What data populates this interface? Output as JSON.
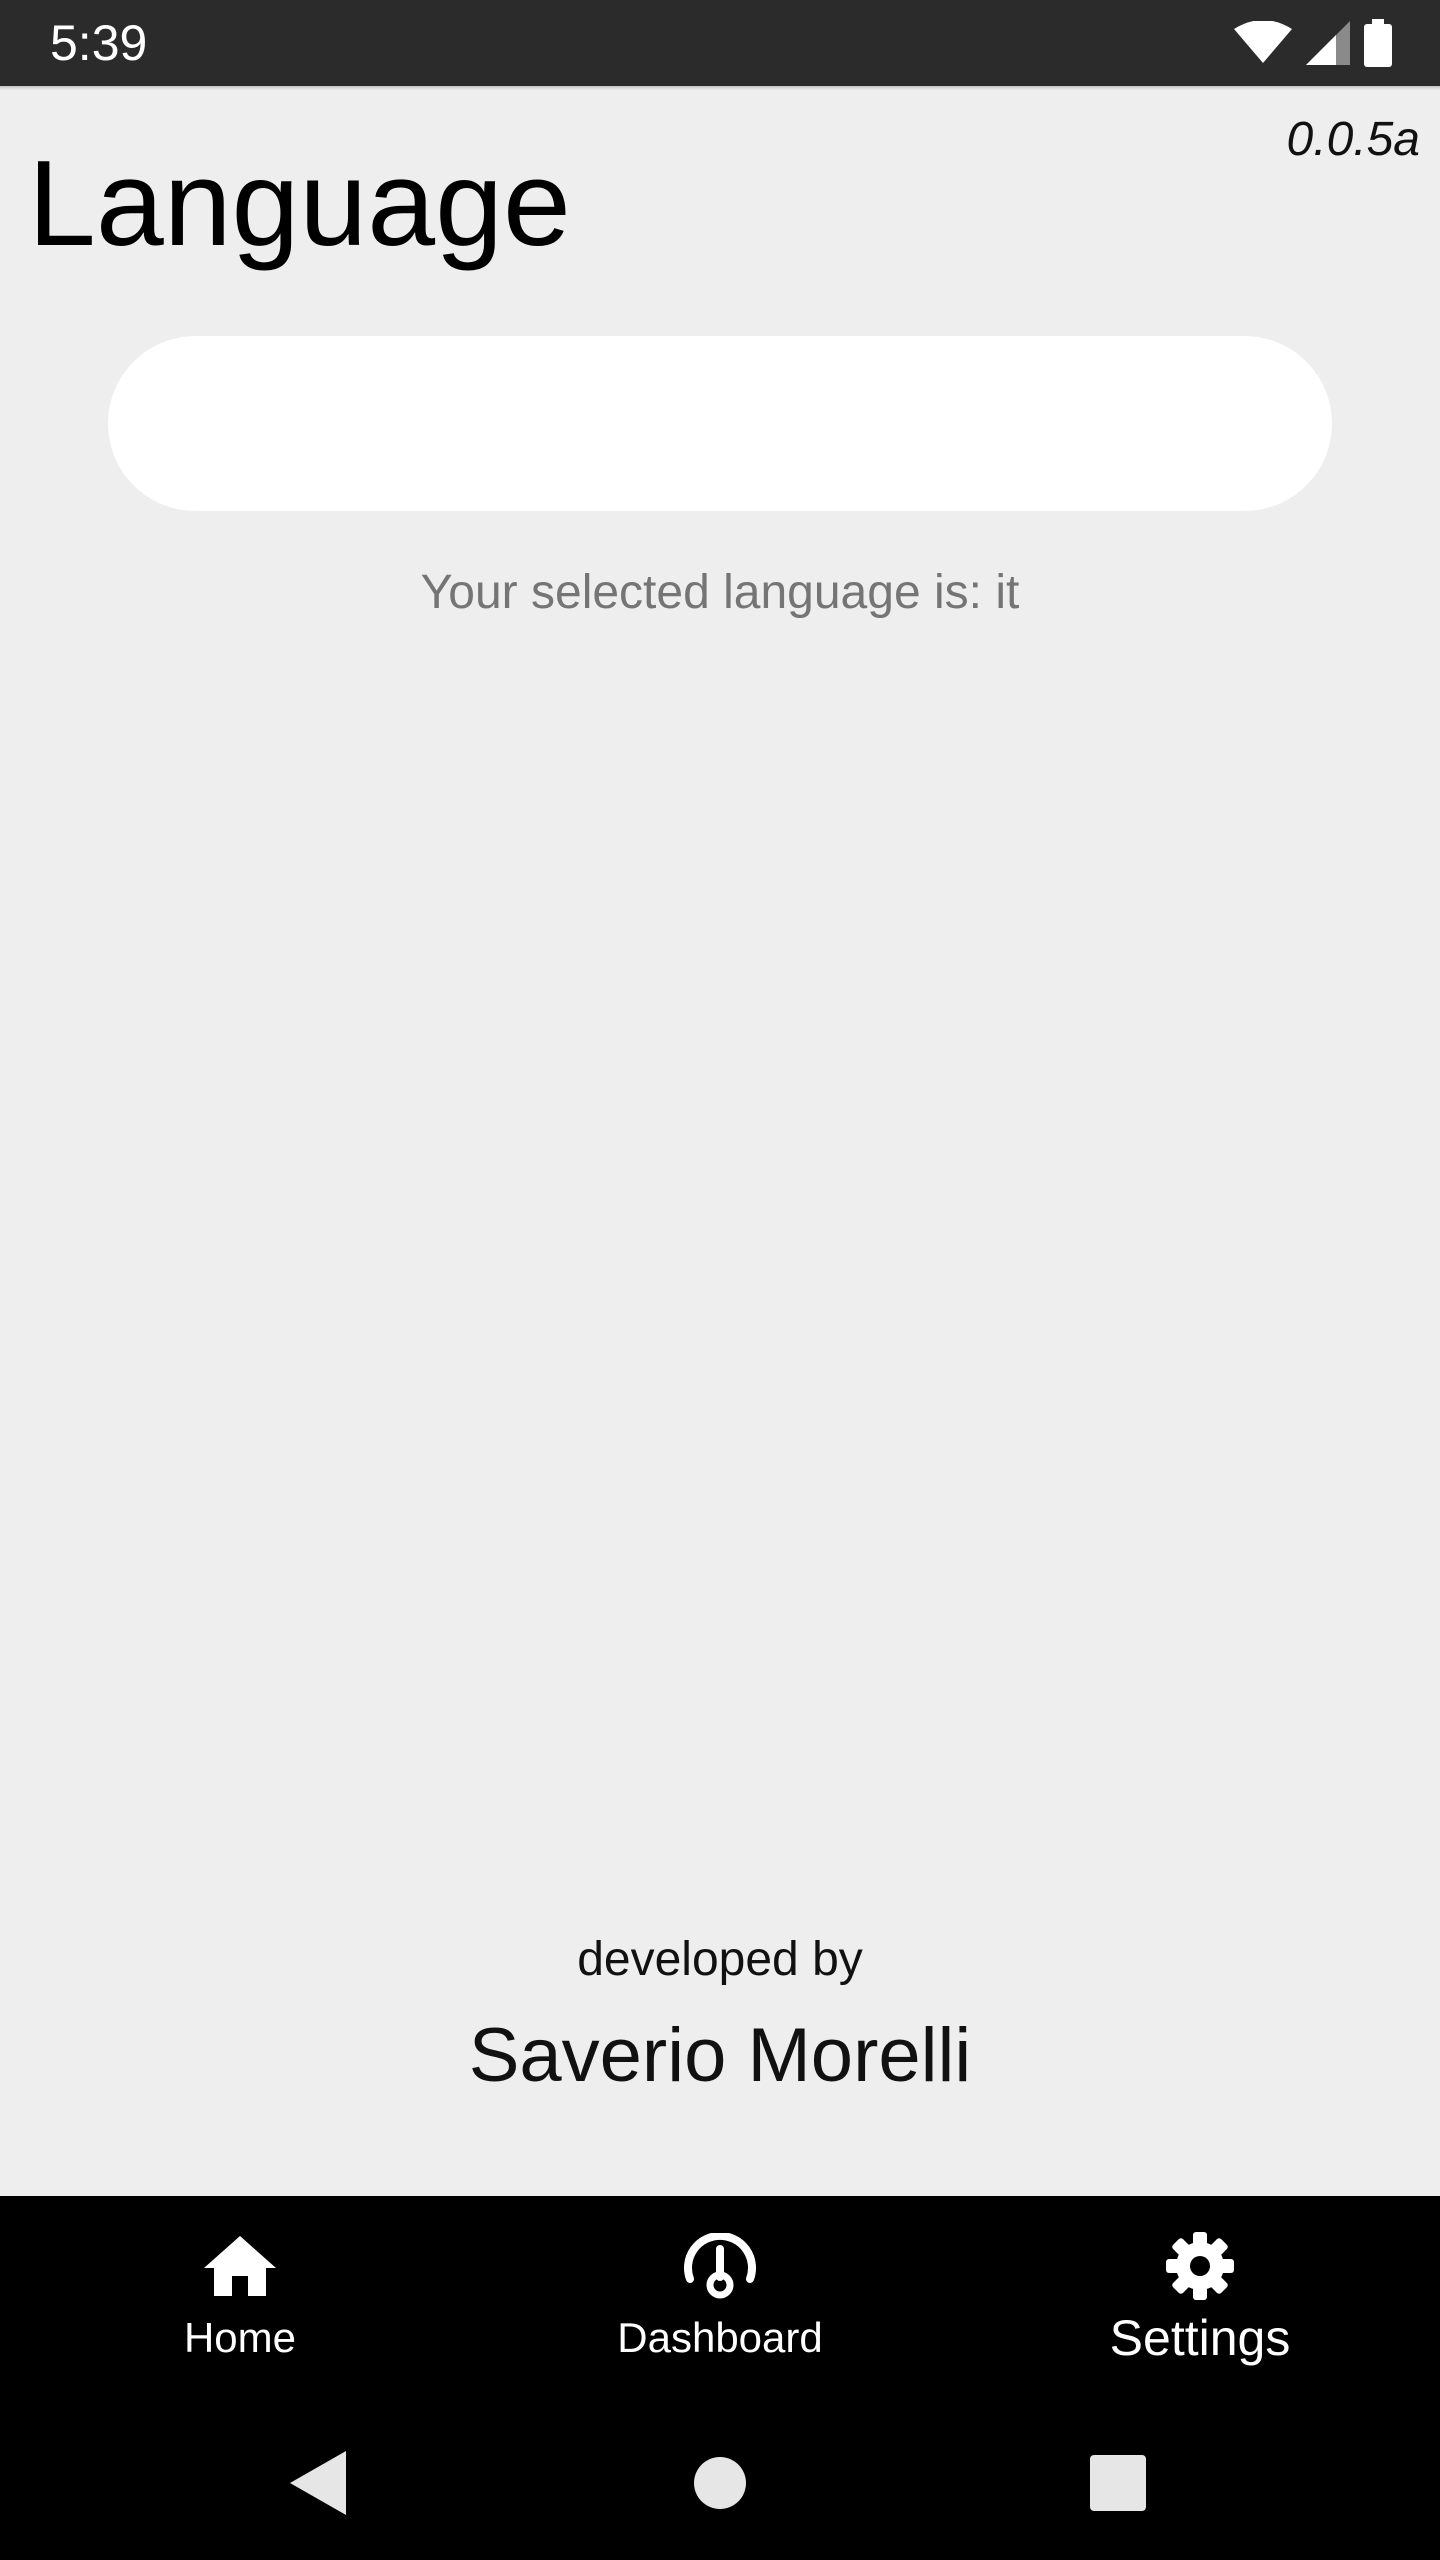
{
  "status_bar": {
    "time": "5:39",
    "icons": [
      "wifi-icon",
      "signal-icon",
      "battery-icon"
    ]
  },
  "header": {
    "title": "Language",
    "version": "0.0.5a"
  },
  "language_select": {
    "value": ""
  },
  "selected_language_text": "Your selected language is: it",
  "footer": {
    "developed_by_label": "developed by",
    "developer_name": "Saverio Morelli"
  },
  "bottom_nav": {
    "items": [
      {
        "label": "Home",
        "icon": "home-icon",
        "active": false
      },
      {
        "label": "Dashboard",
        "icon": "dashboard-icon",
        "active": false
      },
      {
        "label": "Settings",
        "icon": "gear-icon",
        "active": true
      }
    ]
  },
  "system_nav": {
    "buttons": [
      "back-icon",
      "home-circle-icon",
      "recents-icon"
    ]
  },
  "colors": {
    "background": "#eeeeee",
    "status_bar": "#2b2b2b",
    "nav_bar": "#000000",
    "field": "#ffffff",
    "muted_text": "#757575"
  }
}
